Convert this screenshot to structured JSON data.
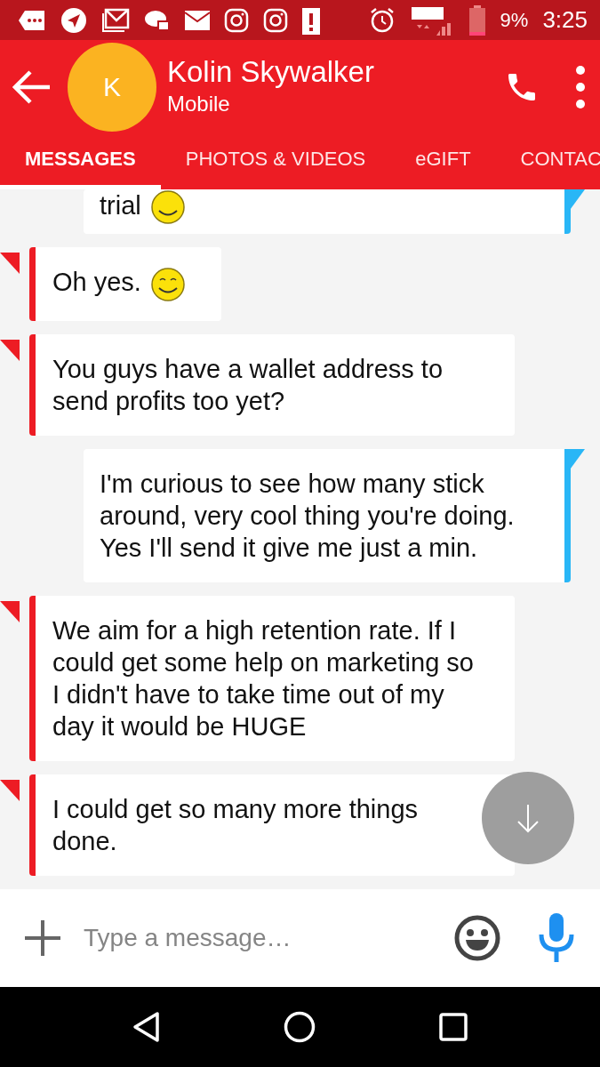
{
  "status_bar": {
    "battery": "9%",
    "time": "3:25"
  },
  "header": {
    "avatar_letter": "K",
    "name": "Kolin Skywalker",
    "subtitle": "Mobile"
  },
  "tabs": [
    {
      "label": "MESSAGES",
      "selected": true
    },
    {
      "label": "PHOTOS & VIDEOS",
      "selected": false
    },
    {
      "label": "eGIFT",
      "selected": false
    },
    {
      "label": "CONTAC",
      "selected": false
    }
  ],
  "messages": [
    {
      "kind": "outgoing",
      "text": "trial",
      "emoji": true
    },
    {
      "kind": "incoming",
      "text": "Oh yes.",
      "emoji": true
    },
    {
      "kind": "incoming",
      "text": "You guys have a wallet address to send profits too yet?",
      "emoji": false
    },
    {
      "kind": "outgoing",
      "text": "I'm curious to see how many stick around, very cool thing you're doing. Yes I'll send it give me just a min.",
      "emoji": false
    },
    {
      "kind": "incoming",
      "text": "We aim for a high retention rate. If I could get some help on marketing so I didn't have to take time out of my day it would be HUGE",
      "emoji": false
    },
    {
      "kind": "incoming",
      "text": "I could get so many more things done.",
      "emoji": false
    }
  ],
  "composer": {
    "placeholder": "Type a message…"
  }
}
